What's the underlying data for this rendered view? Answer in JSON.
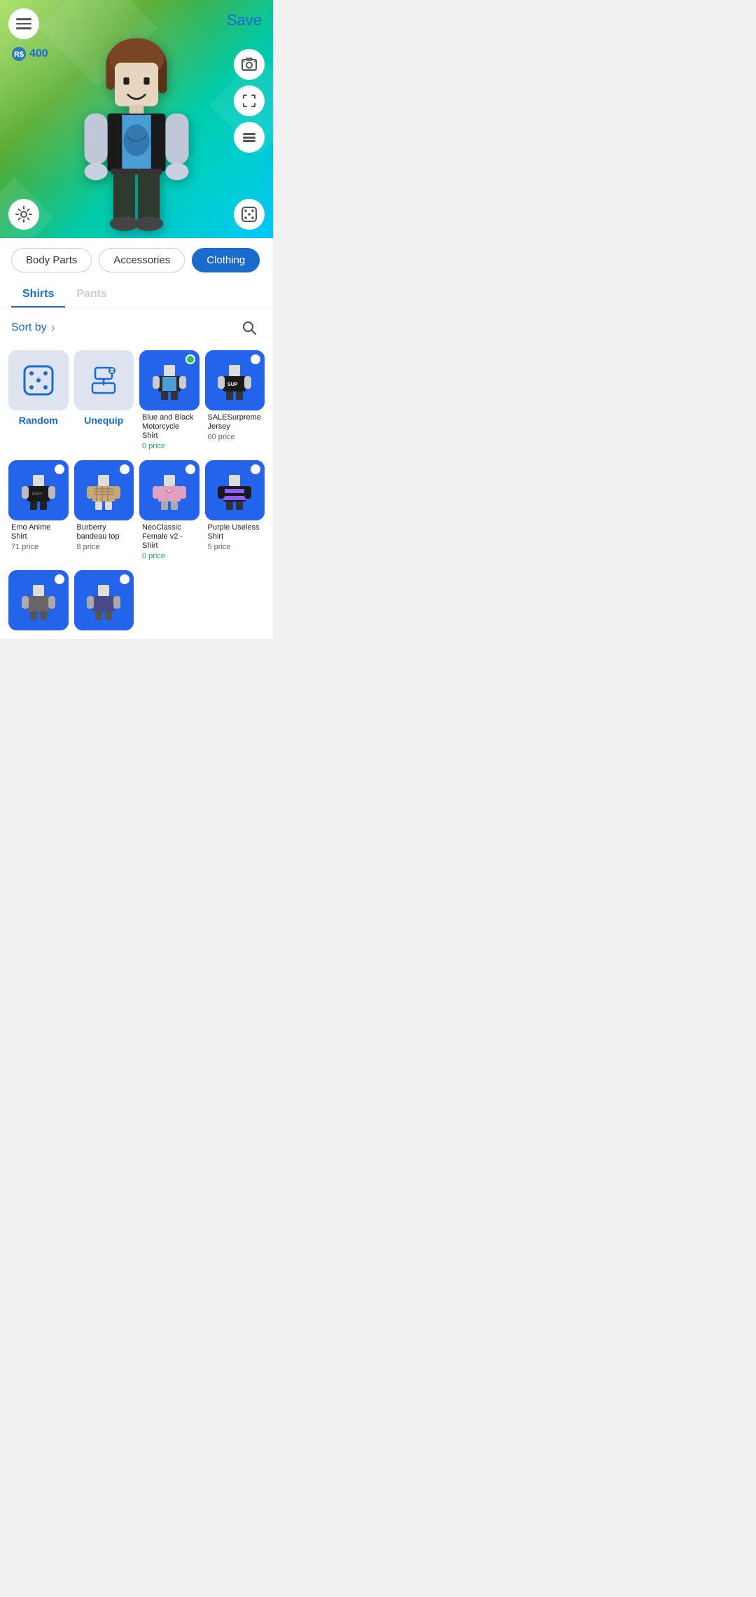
{
  "header": {
    "save_label": "Save",
    "currency": "400"
  },
  "categories": [
    {
      "id": "body-parts",
      "label": "Body Parts",
      "active": false
    },
    {
      "id": "accessories",
      "label": "Accessories",
      "active": false
    },
    {
      "id": "clothing",
      "label": "Clothing",
      "active": true
    }
  ],
  "sub_tabs": [
    {
      "id": "shirts",
      "label": "Shirts",
      "active": true
    },
    {
      "id": "pants",
      "label": "Pants",
      "active": false
    }
  ],
  "sort_by_label": "Sort by",
  "grid_items": [
    {
      "id": "random",
      "label": "Random",
      "type": "action",
      "color": "light",
      "price": "",
      "status": null
    },
    {
      "id": "unequip",
      "label": "Unequip",
      "type": "action",
      "color": "light",
      "price": "",
      "status": null
    },
    {
      "id": "blue-black-shirt",
      "label": "Blue and Black Motorcycle Shirt",
      "type": "item",
      "color": "blue",
      "price": "0 price",
      "price_free": true,
      "status": "green"
    },
    {
      "id": "sale-supreme",
      "label": "SALESurpreme Jersey",
      "type": "item",
      "color": "blue",
      "price": "60 price",
      "price_free": false,
      "status": "white"
    },
    {
      "id": "emo-anime-shirt",
      "label": "Emo Anime Shirt",
      "type": "item",
      "color": "blue",
      "price": "71 price",
      "price_free": false,
      "status": "white"
    },
    {
      "id": "burberry",
      "label": "Burberry bandeau top",
      "type": "item",
      "color": "blue",
      "price": "8 price",
      "price_free": false,
      "status": "white"
    },
    {
      "id": "neoclassic-female",
      "label": "NeoClassic Female v2 - Shirt",
      "type": "item",
      "color": "blue",
      "price": "0 price",
      "price_free": true,
      "status": "white"
    },
    {
      "id": "purple-useless",
      "label": "Purple Useless Shirt",
      "type": "item",
      "color": "blue",
      "price": "5 price",
      "price_free": false,
      "status": "white"
    },
    {
      "id": "extra1",
      "label": "",
      "type": "item",
      "color": "blue",
      "price": "",
      "price_free": false,
      "status": "white"
    },
    {
      "id": "extra2",
      "label": "",
      "type": "item",
      "color": "blue",
      "price": "",
      "price_free": false,
      "status": "white"
    }
  ]
}
